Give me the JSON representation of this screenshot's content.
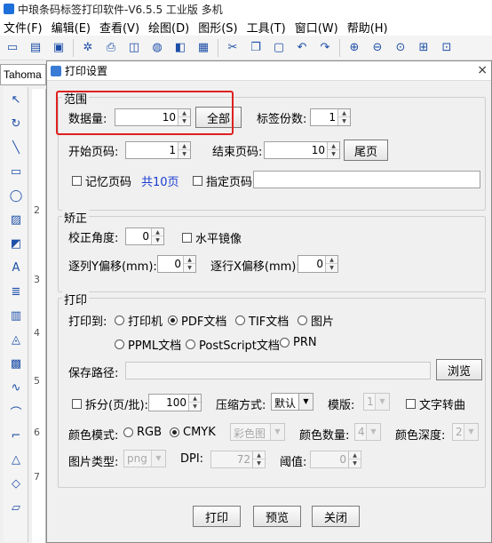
{
  "app": {
    "title": "中琅条码标签打印软件-V6.5.5 工业版 多机",
    "menus": [
      "文件(F)",
      "编辑(E)",
      "查看(V)",
      "绘图(D)",
      "图形(S)",
      "工具(T)",
      "窗口(W)",
      "帮助(H)"
    ],
    "font_name": "Tahoma"
  },
  "ruler": {
    "labels": [
      "2",
      "3",
      "4",
      "5",
      "6",
      "7"
    ]
  },
  "dialog": {
    "title": "打印设置",
    "close": "×",
    "range": {
      "title": "范围",
      "data_count_label": "数据量:",
      "data_count_value": "10",
      "all_button": "全部",
      "copies_label": "标签份数:",
      "copies_value": "1",
      "start_page_label": "开始页码:",
      "start_page_value": "1",
      "end_page_label": "结束页码:",
      "end_page_value": "10",
      "last_page_button": "尾页",
      "remember_page_label": "记忆页码",
      "total_pages_text": "共10页",
      "specify_page_label": "指定页码"
    },
    "correction": {
      "title": "矫正",
      "angle_label": "校正角度:",
      "angle_value": "0",
      "mirror_label": "水平镜像",
      "col_y_label": "逐列Y偏移(mm):",
      "col_y_value": "0",
      "row_x_label": "逐行X偏移(mm):",
      "row_x_value": "0"
    },
    "print": {
      "title": "打印",
      "print_to_label": "打印到:",
      "targets_row1": [
        "打印机",
        "PDF文档",
        "TIF文档",
        "图片"
      ],
      "targets_row2": [
        "PPML文档",
        "PostScript文档",
        "PRN"
      ],
      "selected_target": "PDF文档",
      "save_path_label": "保存路径:",
      "browse_button": "浏览",
      "split_label": "拆分(页/批):",
      "split_value": "100",
      "compress_label": "压缩方式:",
      "compress_value": "默认",
      "template_label": "模版:",
      "template_value": "1",
      "text_to_curve_label": "文字转曲",
      "color_mode_label": "颜色模式:",
      "color_modes": [
        "RGB",
        "CMYK"
      ],
      "selected_color_mode": "CMYK",
      "color_mode_combo": "彩色图",
      "color_count_label": "颜色数量:",
      "color_count_value": "4",
      "color_depth_label": "颜色深度:",
      "color_depth_value": "2",
      "image_type_label": "图片类型:",
      "image_type_value": "png",
      "dpi_label": "DPI:",
      "dpi_value": "72",
      "threshold_label": "阈值:",
      "threshold_value": "0"
    },
    "buttons": {
      "print": "打印",
      "preview": "预览",
      "close": "关闭"
    }
  },
  "colors": {
    "highlight": "#e02020",
    "total_pages": "#1a3dd0"
  }
}
